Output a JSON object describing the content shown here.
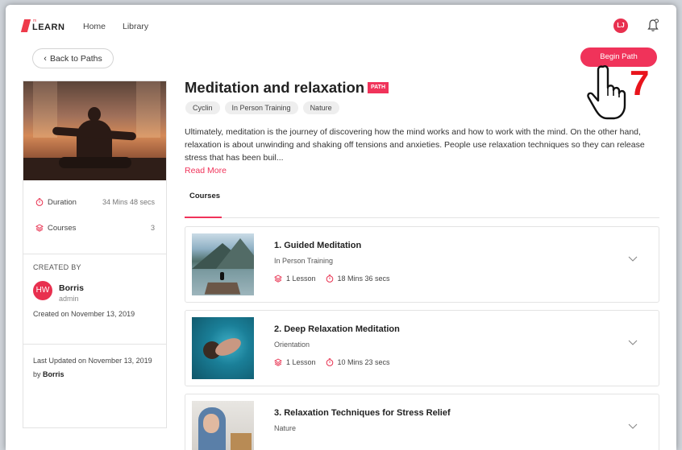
{
  "nav": {
    "logo_sup": "m",
    "logo_text": "LEARN",
    "home": "Home",
    "library": "Library",
    "user_initials": "LJ"
  },
  "back_label": "Back to Paths",
  "begin_label": "Begin Path",
  "annotation_step": "7",
  "path": {
    "title": "Meditation and relaxation",
    "badge": "PATH",
    "tags": [
      "Cyclin",
      "In Person Training",
      "Nature"
    ],
    "description": "Ultimately, meditation is the journey of discovering how the mind works and how to work with the mind. On the other hand, relaxation is about unwinding and shaking off tensions and anxieties. People use relaxation techniques so they can release stress that has been buil...",
    "read_more": "Read More"
  },
  "sidebar": {
    "duration_label": "Duration",
    "duration_value": "34 Mins 48 secs",
    "courses_label": "Courses",
    "courses_value": "3",
    "created_by_label": "CREATED BY",
    "author_initials": "HW",
    "author_name": "Borris",
    "author_role": "admin",
    "created_on": "Created on November 13, 2019",
    "updated_on": "Last Updated on November 13, 2019",
    "updated_by_prefix": "by",
    "updated_by_name": "Borris"
  },
  "tabs": {
    "courses": "Courses"
  },
  "courses": [
    {
      "title": "1. Guided Meditation",
      "category": "In Person Training",
      "lessons": "1 Lesson",
      "duration": "18 Mins 36 secs"
    },
    {
      "title": "2. Deep Relaxation Meditation",
      "category": "Orientation",
      "lessons": "1 Lesson",
      "duration": "10 Mins 23 secs"
    },
    {
      "title": "3. Relaxation Techniques for Stress Relief",
      "category": "Nature",
      "lessons": "",
      "duration": ""
    }
  ],
  "colors": {
    "accent": "#f0335a",
    "annotation": "#e8141c"
  }
}
